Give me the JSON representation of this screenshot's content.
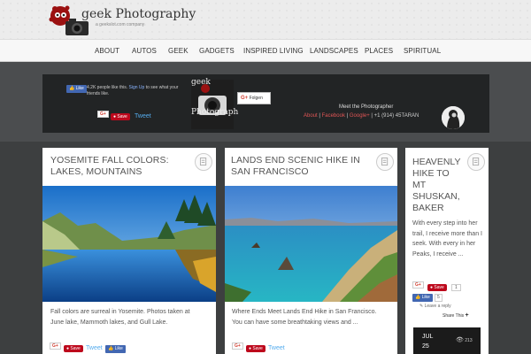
{
  "header": {
    "site_title": "geek Photography",
    "tagline": "a geekslot.com company"
  },
  "nav": {
    "items": [
      "ABOUT",
      "AUTOS",
      "GEEK",
      "GADGETS",
      "INSPIRED LIVING",
      "LANDSCAPES",
      "PLACES",
      "SPIRITUAL"
    ]
  },
  "social": {
    "fb_like": "Like",
    "fb_text_count": "4.2K people like this.",
    "fb_text_signup": "Sign Up",
    "fb_text_rest": "to see what your friends like.",
    "gplus": "G+",
    "save": "Save",
    "tweet": "Tweet",
    "mid_logo_top": "geek",
    "mid_logo_bottom": "Photograph",
    "follow": "Folgen",
    "photographer_title": "Meet the Photographer",
    "links": {
      "about": "About",
      "facebook": "Facebook",
      "google": "Google+",
      "sep": "|",
      "phone": "+1 (914) 45TARAN"
    }
  },
  "posts": [
    {
      "title_line1": "YOSEMITE FALL COLORS:",
      "title_line2": "LAKES, MOUNTAINS",
      "excerpt_line1": "Fall colors are surreal in Yosemite. Photos taken at",
      "excerpt_line2": "June lake, Mammoth lakes, and Gull Lake.",
      "gplus": "G+",
      "save": "Save",
      "tweet": "Tweet",
      "fb_like": "Like"
    },
    {
      "title_line1": "LANDS END SCENIC HIKE IN",
      "title_line2": "SAN FRANCISCO",
      "excerpt_line1": "Where Ends Meet Lands End Hike in San Francisco.",
      "excerpt_line2": "You can have some breathtaking views and ...",
      "gplus": "G+",
      "save": "Save",
      "tweet": "Tweet"
    }
  ],
  "side_post": {
    "title_lines": [
      "HEAVENLY",
      "HIKE TO",
      "MT",
      "SHUSKAN,",
      "BAKER"
    ],
    "excerpt": "With every step into her trail, I receive more than I seek. With every in her Peaks, I receive ...",
    "gplus": "G+",
    "save": "Save",
    "count": "1",
    "fb_like": "Like",
    "fb_count": "5",
    "leave_reply": "Leave a reply",
    "share_this": "Share This",
    "date_month": "JUL",
    "date_day": "25",
    "views": "213"
  },
  "colors": {
    "header_bg": "#ececec",
    "band": "#4b4d4f",
    "social_bg": "#222425",
    "link_red": "#e05555",
    "pinterest": "#bd081c",
    "facebook": "#4267b2",
    "twitter": "#55acee"
  }
}
